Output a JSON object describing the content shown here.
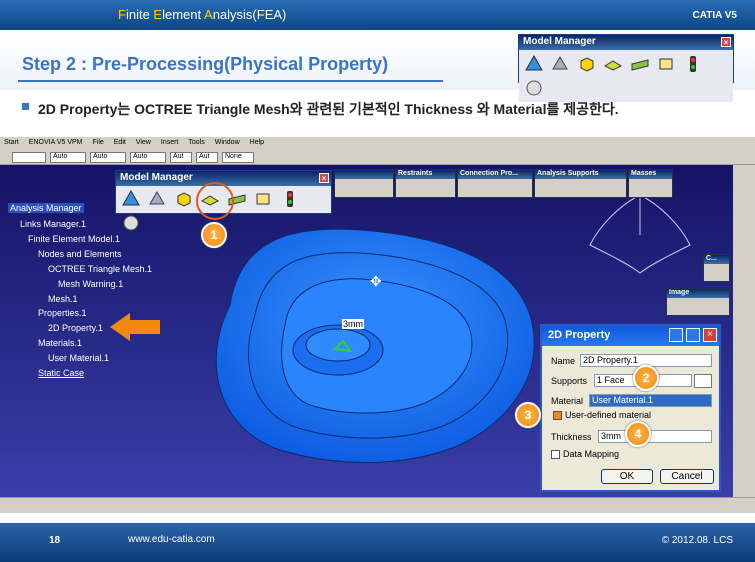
{
  "header": {
    "title_parts": [
      "F",
      "inite ",
      "E",
      "lement ",
      "A",
      "nalysis(FEA)"
    ],
    "brand": "CATIA V5"
  },
  "step": {
    "title": "Step 2 : Pre-Processing(Physical Property)",
    "description": "2D Property는 OCTREE Triangle Mesh와 관련된 기본적인 Thickness 와 Material를 제공한다."
  },
  "model_manager": {
    "title": "Model Manager",
    "close": "×"
  },
  "menu": [
    "Start",
    "ENOVIA V5 VPM",
    "File",
    "Edit",
    "View",
    "Insert",
    "Tools",
    "Window",
    "Help"
  ],
  "selects": [
    "Auto",
    "Auto",
    "Auto",
    "Aut",
    "Aut",
    "None"
  ],
  "toolbars": [
    "Restraints",
    "Connection Pro...",
    "Analysis Supports",
    "Masses",
    "C...",
    "Image"
  ],
  "tree": [
    "Analysis Manager",
    "Links Manager.1",
    "Finite Element Model.1",
    "Nodes and Elements",
    "OCTREE Triangle Mesh.1",
    "Mesh Warning.1",
    "Mesh.1",
    "Properties.1",
    "2D Property.1",
    "Materials.1",
    "User Material.1",
    "Static Case"
  ],
  "viewport": {
    "thickness_label": "3mm"
  },
  "dialog": {
    "title": "2D Property",
    "name_label": "Name",
    "name_value": "2D Property.1",
    "supports_label": "Supports",
    "supports_value": "1 Face",
    "material_label": "Material",
    "material_value": "User Material.1",
    "user_defined": "User-defined material",
    "thickness_label": "Thickness",
    "thickness_value": "3mm",
    "data_mapping": "Data Mapping",
    "ok": "OK",
    "cancel": "Cancel"
  },
  "callouts": [
    "1",
    "2",
    "3",
    "4"
  ],
  "footer": {
    "page": "18",
    "url": "www.edu-catia.com",
    "copyright": "© 2012.08. LCS"
  },
  "colors": {
    "accent": "#3b74c3",
    "part_blue": "#1e7bff",
    "callout": "#f08a10",
    "bg": "#141466"
  }
}
